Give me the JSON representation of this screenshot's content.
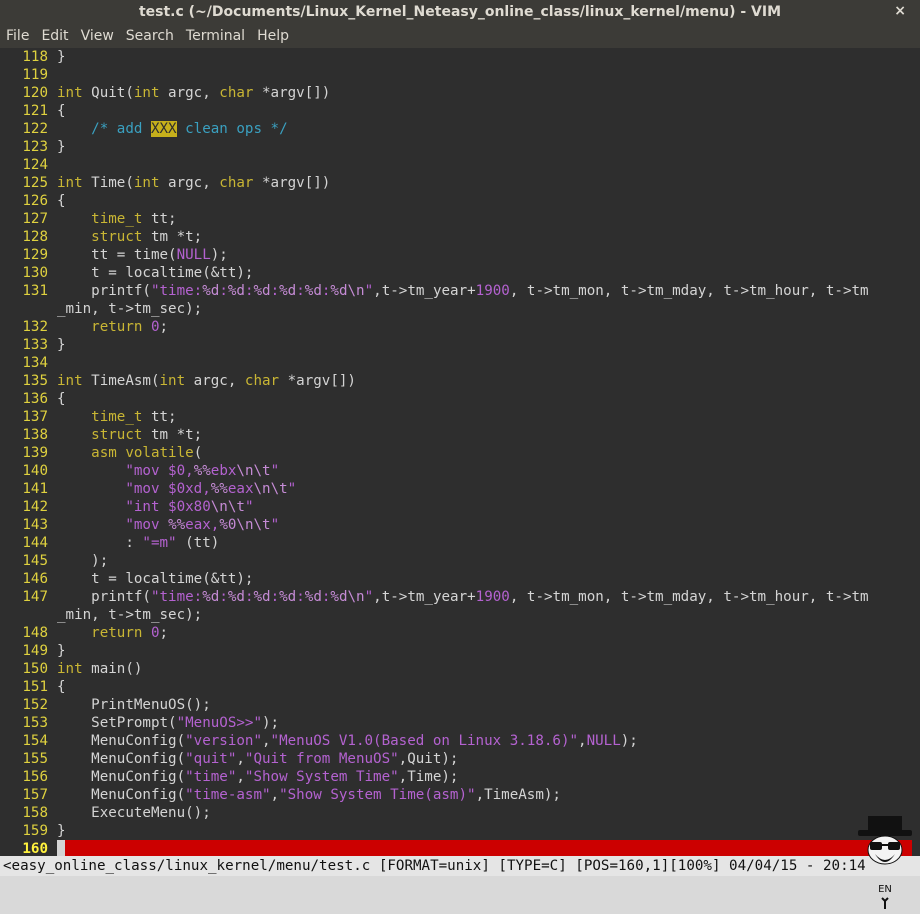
{
  "window": {
    "title": "test.c (~/Documents/Linux_Kernel_Neteasy_online_class/linux_kernel/menu) - VIM",
    "close_glyph": "×"
  },
  "menu": [
    "File",
    "Edit",
    "View",
    "Search",
    "Terminal",
    "Help"
  ],
  "code_lines": [
    {
      "n": "118",
      "html": "}"
    },
    {
      "n": "119",
      "html": ""
    },
    {
      "n": "120",
      "html": "<span class='t'>int</span> Quit(<span class='t'>int</span> argc, <span class='t'>char</span> *argv[])"
    },
    {
      "n": "121",
      "html": "{"
    },
    {
      "n": "122",
      "html": "    <span class='c'>/* add </span><span class='todo'>XXX</span><span class='c'> clean ops */</span>"
    },
    {
      "n": "123",
      "html": "}"
    },
    {
      "n": "124",
      "html": ""
    },
    {
      "n": "125",
      "html": "<span class='t'>int</span> Time(<span class='t'>int</span> argc, <span class='t'>char</span> *argv[])"
    },
    {
      "n": "126",
      "html": "{"
    },
    {
      "n": "127",
      "html": "    <span class='t'>time_t</span> tt;"
    },
    {
      "n": "128",
      "html": "    <span class='t'>struct</span> tm *t;"
    },
    {
      "n": "129",
      "html": "    tt = time(<span class='s'>NULL</span>);"
    },
    {
      "n": "130",
      "html": "    t = localtime(&amp;tt);"
    },
    {
      "n": "131",
      "html": "    printf(<span class='s'>\"time:</span><span class='e'>%d</span><span class='s'>:</span><span class='e'>%d</span><span class='s'>:</span><span class='e'>%d</span><span class='s'>:</span><span class='e'>%d</span><span class='s'>:</span><span class='e'>%d</span><span class='s'>:</span><span class='e'>%d</span><span class='e'>\\n</span><span class='s'>\"</span>,t-&gt;tm_year+<span class='s'>1900</span>, t-&gt;tm_mon, t-&gt;tm_mday, t-&gt;tm_hour, t-&gt;tm"
    },
    {
      "n": "",
      "html": "_min, t-&gt;tm_sec);"
    },
    {
      "n": "132",
      "html": "    <span class='t'>return</span> <span class='s'>0</span>;"
    },
    {
      "n": "133",
      "html": "}"
    },
    {
      "n": "134",
      "html": ""
    },
    {
      "n": "135",
      "html": "<span class='t'>int</span> TimeAsm(<span class='t'>int</span> argc, <span class='t'>char</span> *argv[])"
    },
    {
      "n": "136",
      "html": "{"
    },
    {
      "n": "137",
      "html": "    <span class='t'>time_t</span> tt;"
    },
    {
      "n": "138",
      "html": "    <span class='t'>struct</span> tm *t;"
    },
    {
      "n": "139",
      "html": "    <span class='t'>asm</span> <span class='t'>volatile</span>("
    },
    {
      "n": "140",
      "html": "        <span class='s'>\"mov $0,</span><span class='e'>%%</span><span class='s'>ebx</span><span class='e'>\\n\\t</span><span class='s'>\"</span>"
    },
    {
      "n": "141",
      "html": "        <span class='s'>\"mov $0xd,</span><span class='e'>%%</span><span class='s'>eax</span><span class='e'>\\n\\t</span><span class='s'>\"</span>"
    },
    {
      "n": "142",
      "html": "        <span class='s'>\"int $0x80</span><span class='e'>\\n\\t</span><span class='s'>\"</span>"
    },
    {
      "n": "143",
      "html": "        <span class='s'>\"mov </span><span class='e'>%%</span><span class='s'>eax,</span><span class='e'>%0</span><span class='e'>\\n\\t</span><span class='s'>\"</span>"
    },
    {
      "n": "144",
      "html": "        : <span class='s'>\"=m\"</span> (tt)"
    },
    {
      "n": "145",
      "html": "    );"
    },
    {
      "n": "146",
      "html": "    t = localtime(&amp;tt);"
    },
    {
      "n": "147",
      "html": "    printf(<span class='s'>\"time:</span><span class='e'>%d</span><span class='s'>:</span><span class='e'>%d</span><span class='s'>:</span><span class='e'>%d</span><span class='s'>:</span><span class='e'>%d</span><span class='s'>:</span><span class='e'>%d</span><span class='s'>:</span><span class='e'>%d</span><span class='e'>\\n</span><span class='s'>\"</span>,t-&gt;tm_year+<span class='s'>1900</span>, t-&gt;tm_mon, t-&gt;tm_mday, t-&gt;tm_hour, t-&gt;tm"
    },
    {
      "n": "",
      "html": "_min, t-&gt;tm_sec);"
    },
    {
      "n": "148",
      "html": "    <span class='t'>return</span> <span class='s'>0</span>;"
    },
    {
      "n": "149",
      "html": "}"
    },
    {
      "n": "150",
      "html": "<span class='t'>int</span> main()"
    },
    {
      "n": "151",
      "html": "{"
    },
    {
      "n": "152",
      "html": "    PrintMenuOS();"
    },
    {
      "n": "153",
      "html": "    SetPrompt(<span class='s'>\"MenuOS&gt;&gt;\"</span>);"
    },
    {
      "n": "154",
      "html": "    MenuConfig(<span class='s'>\"version\"</span>,<span class='s'>\"MenuOS V1.0(Based on Linux 3.18.6)\"</span>,<span class='s'>NULL</span>);"
    },
    {
      "n": "155",
      "html": "    MenuConfig(<span class='s'>\"quit\"</span>,<span class='s'>\"Quit from MenuOS\"</span>,Quit);"
    },
    {
      "n": "156",
      "html": "    MenuConfig(<span class='s'>\"time\"</span>,<span class='s'>\"Show System Time\"</span>,Time);"
    },
    {
      "n": "157",
      "html": "    MenuConfig(<span class='s'>\"time-asm\"</span>,<span class='s'>\"Show System Time(asm)\"</span>,TimeAsm);"
    },
    {
      "n": "158",
      "html": "    ExecuteMenu();"
    },
    {
      "n": "159",
      "html": "}"
    },
    {
      "n": "160",
      "html": "",
      "cursor": true
    }
  ],
  "statusline": "<easy_online_class/linux_kernel/menu/test.c [FORMAT=unix] [TYPE=C] [POS=160,1][100%] 04/04/15 - 20:14",
  "avatar_label": "EN",
  "colors": {
    "cursorline": "#cc0000",
    "linenr": "#dfd13f",
    "background": "#2e2e2e"
  }
}
